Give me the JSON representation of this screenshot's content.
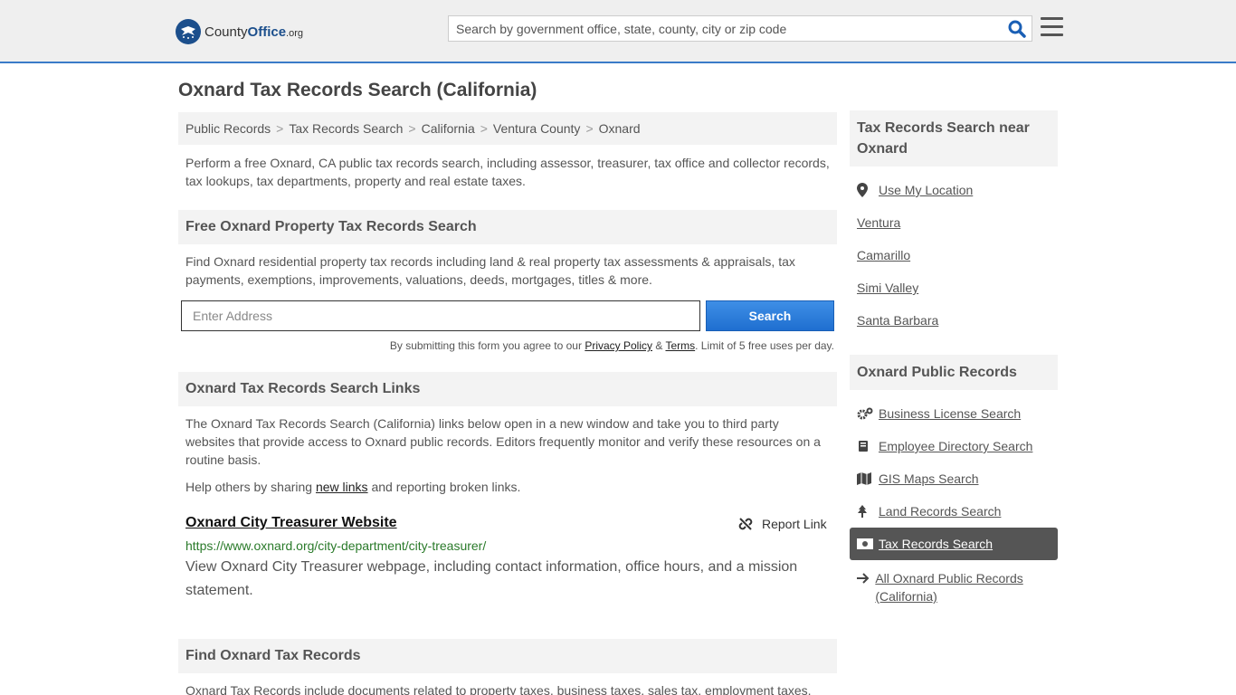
{
  "header": {
    "logo_main": "County",
    "logo_strong": "Office",
    "logo_suffix": ".org",
    "search_placeholder": "Search by government office, state, county, city or zip code"
  },
  "page": {
    "title": "Oxnard Tax Records Search (California)",
    "breadcrumb": [
      "Public Records",
      "Tax Records Search",
      "California",
      "Ventura County",
      "Oxnard"
    ],
    "intro": "Perform a free Oxnard, CA public tax records search, including assessor, treasurer, tax office and collector records, tax lookups, tax departments, property and real estate taxes."
  },
  "property_search": {
    "heading": "Free Oxnard Property Tax Records Search",
    "text": "Find Oxnard residential property tax records including land & real property tax assessments & appraisals, tax payments, exemptions, improvements, valuations, deeds, mortgages, titles & more.",
    "input_placeholder": "Enter Address",
    "button": "Search",
    "disclaimer_pre": "By submitting this form you agree to our ",
    "privacy": "Privacy Policy",
    "amp": " & ",
    "terms": "Terms",
    "disclaimer_post": ". Limit of 5 free uses per day."
  },
  "links_section": {
    "heading": "Oxnard Tax Records Search Links",
    "text": "The Oxnard Tax Records Search (California) links below open in a new window and take you to third party websites that provide access to Oxnard public records. Editors frequently monitor and verify these resources on a routine basis.",
    "help_pre": "Help others by sharing ",
    "help_link": "new links",
    "help_post": " and reporting broken links.",
    "item": {
      "title": "Oxnard City Treasurer Website",
      "report": "Report Link",
      "url": "https://www.oxnard.org/city-department/city-treasurer/",
      "description": "View Oxnard City Treasurer webpage, including contact information, office hours, and a mission statement."
    }
  },
  "find_section": {
    "heading": "Find Oxnard Tax Records",
    "text": "Oxnard Tax Records include documents related to property taxes, business taxes, sales tax, employment taxes."
  },
  "sidebar": {
    "near_heading": "Tax Records Search near Oxnard",
    "use_location": "Use My Location",
    "near": [
      "Ventura",
      "Camarillo",
      "Simi Valley",
      "Santa Barbara"
    ],
    "public_heading": "Oxnard Public Records",
    "records": [
      {
        "label": "Business License Search",
        "icon": "gears-icon"
      },
      {
        "label": "Employee Directory Search",
        "icon": "book-icon"
      },
      {
        "label": "GIS Maps Search",
        "icon": "map-icon"
      },
      {
        "label": "Land Records Search",
        "icon": "tree-icon"
      },
      {
        "label": "Tax Records Search",
        "icon": "money-icon"
      }
    ],
    "all_records": "All Oxnard Public Records (California)"
  },
  "colors": {
    "accent": "#3a7bc8",
    "button": "#1f6fd0",
    "url_green": "#2a7a2a",
    "active_bg": "#555555"
  }
}
